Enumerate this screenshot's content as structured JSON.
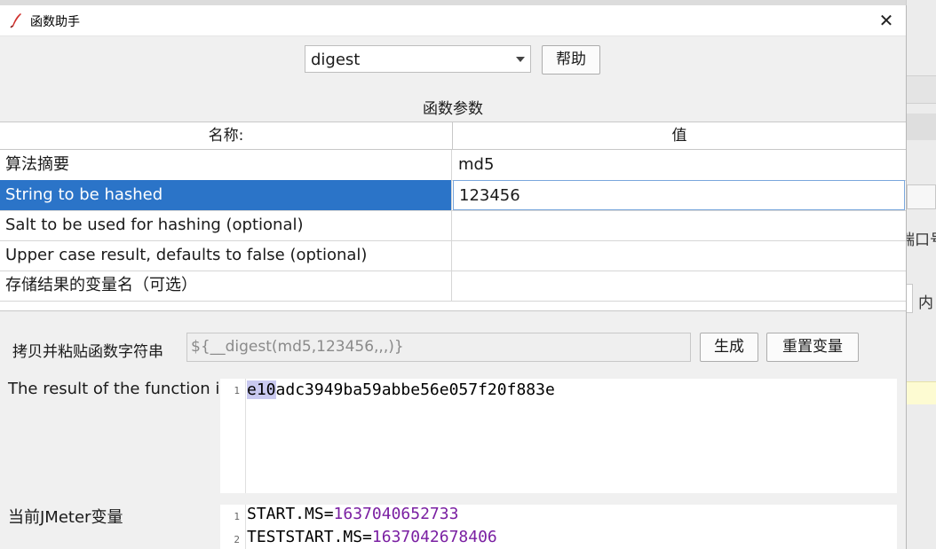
{
  "window": {
    "title": "函数助手",
    "close_glyph": "✕"
  },
  "function_select": {
    "value": "digest",
    "help_label": "帮助"
  },
  "params": {
    "section_title": "函数参数",
    "col_name": "名称:",
    "col_value": "值",
    "rows": [
      {
        "name": "算法摘要",
        "value": "md5"
      },
      {
        "name": "String to be hashed",
        "value": "123456"
      },
      {
        "name": "Salt to be used for hashing (optional)",
        "value": ""
      },
      {
        "name": "Upper case result, defaults to false (optional)",
        "value": ""
      },
      {
        "name": "存储结果的变量名（可选）",
        "value": ""
      }
    ],
    "selected_row": 1
  },
  "copy": {
    "label": "拷贝并粘贴函数字符串",
    "value": "${__digest(md5,123456,,,)}",
    "generate_label": "生成",
    "reset_label": "重置变量"
  },
  "result": {
    "label": "The result of the function is",
    "line_no": "1",
    "highlight": "e10",
    "rest": "adc3949ba59abbe56e057f20f883e"
  },
  "jmeter_vars": {
    "label": "当前JMeter变量",
    "lines": [
      {
        "no": "1",
        "key": "START.MS=",
        "val": "1637040652733"
      },
      {
        "no": "2",
        "key": "TESTSTART.MS=",
        "val": "1637042678406"
      }
    ]
  },
  "background": {
    "frag1": "端口号",
    "frag2": "内"
  },
  "colors": {
    "selection": "#2b74c8",
    "number": "#7a1fa2",
    "match_highlight": "#c9c9f0"
  },
  "icons": {
    "title": "feather-icon",
    "dropdown": "chevron-down-icon",
    "close": "close-icon"
  }
}
